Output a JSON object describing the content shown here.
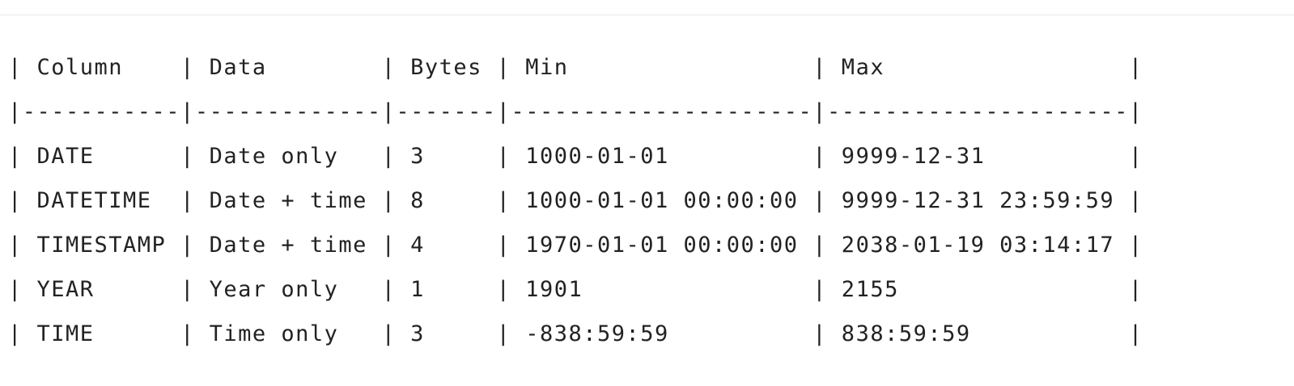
{
  "table": {
    "header": "| Column    | Data        | Bytes | Min                 | Max                 |",
    "separator": "|-----------|-------------|-------|---------------------|---------------------|",
    "rows": [
      "| DATE      | Date only   | 3     | 1000-01-01          | 9999-12-31          |",
      "| DATETIME  | Date + time | 8     | 1000-01-01 00:00:00 | 9999-12-31 23:59:59 |",
      "| TIMESTAMP | Date + time | 4     | 1970-01-01 00:00:00 | 2038-01-19 03:14:17 |",
      "| YEAR      | Year only   | 1     | 1901                | 2155                |",
      "| TIME      | Time only   | 3     | -838:59:59          | 838:59:59           |"
    ]
  }
}
